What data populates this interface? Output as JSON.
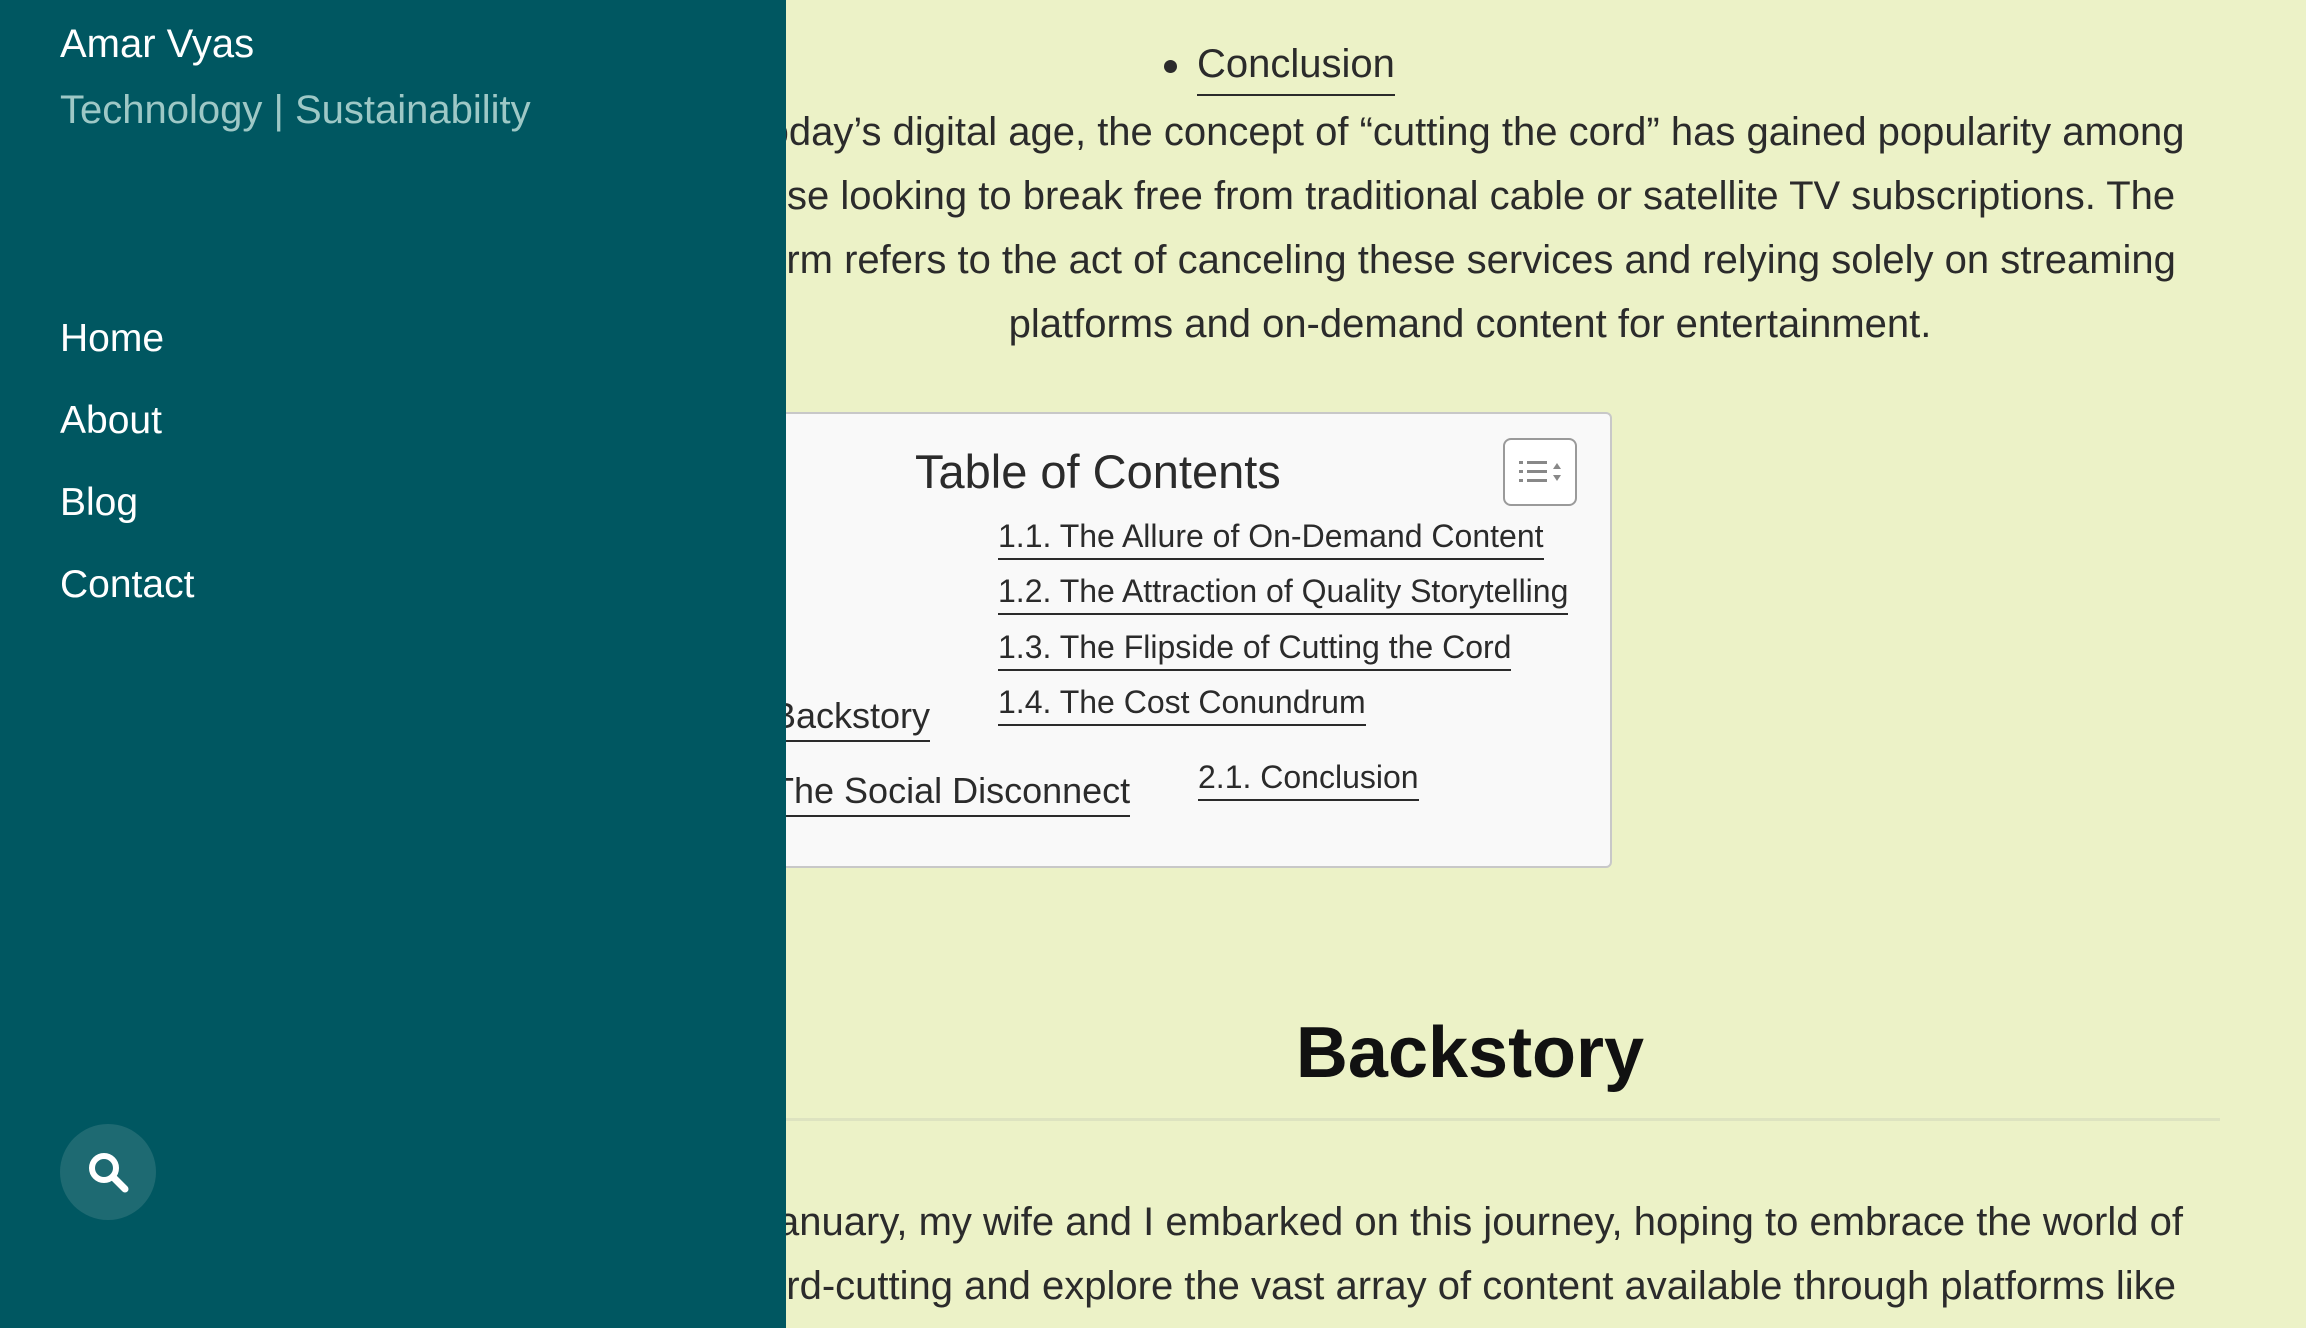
{
  "site": {
    "title": "Amar Vyas",
    "tagline": "Technology | Sustainability"
  },
  "nav": {
    "items": [
      {
        "label": "Home"
      },
      {
        "label": "About"
      },
      {
        "label": "Blog"
      },
      {
        "label": "Contact"
      }
    ],
    "search_icon": "search-icon"
  },
  "article": {
    "bullet_link": "Conclusion",
    "intro_lines": [
      "today’s digital age, the concept of “cutting the cord” has gained popularity among",
      "ose looking to break free from traditional cable or satellite TV subscriptions. The",
      "erm refers to the act of canceling these services and relying solely on streaming",
      "platforms and on-demand content for entertainment."
    ],
    "toc": {
      "title": "Table of Contents",
      "toggle_icon": "list-toggle-icon",
      "sub_items": [
        "1.1. The Allure of On-Demand Content",
        "1.2. The Attraction of Quality Storytelling",
        "1.3. The Flipside of Cutting the Cord",
        "1.4. The Cost Conundrum"
      ],
      "item_backstory": "Backstory",
      "item_social": "The Social Disconnect",
      "item_conclusion": "2.1. Conclusion"
    },
    "section_heading": "Backstory",
    "body_lines": [
      "January, my wife and I embarked on this journey, hoping to embrace the world of",
      "ord-cutting and explore the vast array of content available through platforms like"
    ]
  },
  "colors": {
    "panel_bg": "#005761",
    "page_bg": "#ecf2c7",
    "tagline": "#9ec8c6",
    "search_bg": "#1e6a72"
  }
}
